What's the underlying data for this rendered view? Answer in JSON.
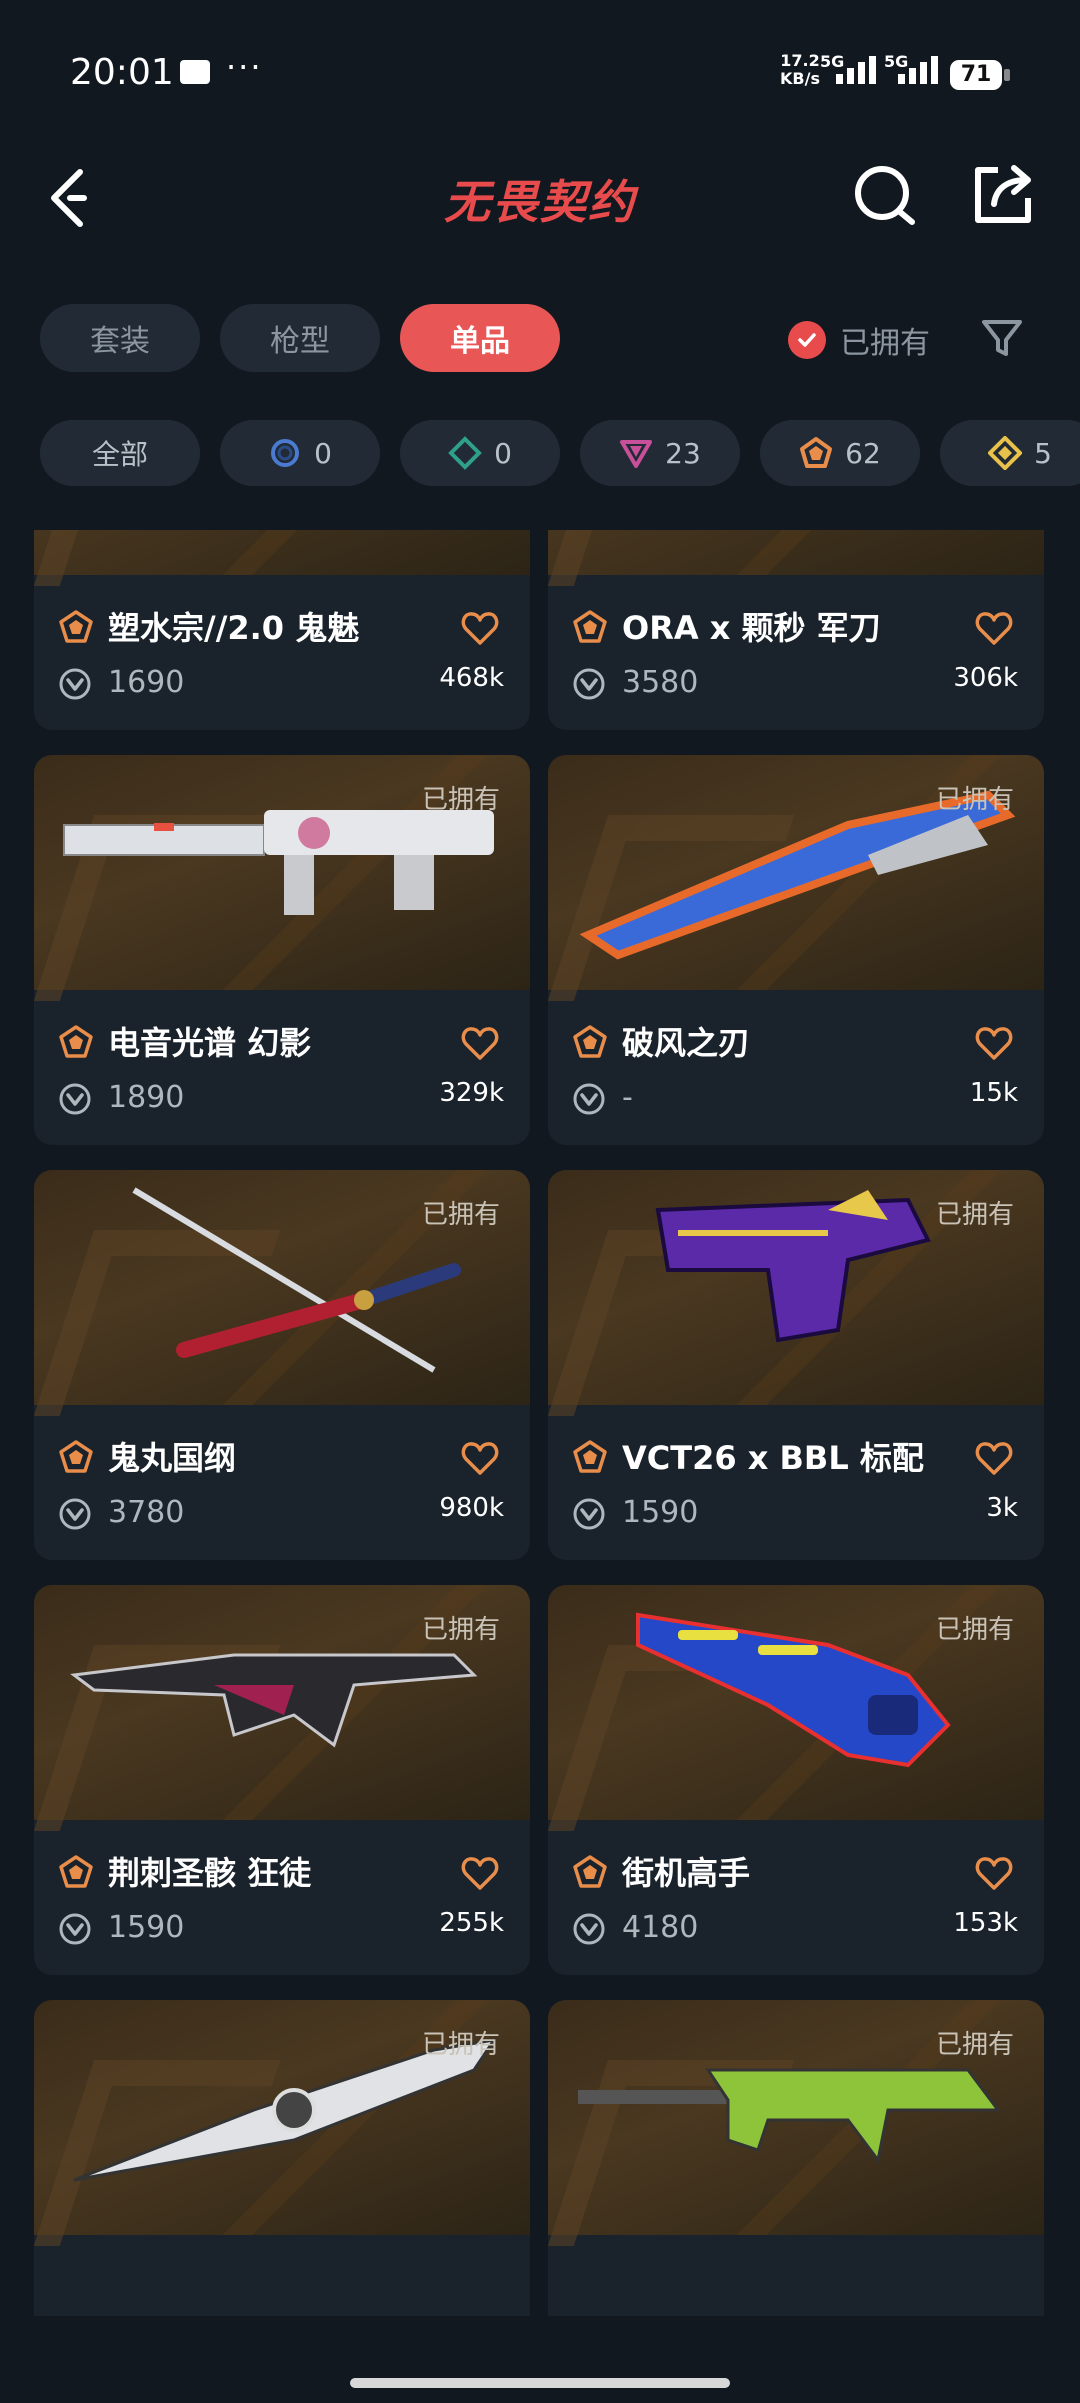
{
  "status": {
    "time": "20:01",
    "net_speed": "17.2",
    "net_unit": "KB/s",
    "sig1_label": "5G",
    "sig2_label": "5G",
    "battery": "71"
  },
  "header": {
    "logo": "无畏契约"
  },
  "tabs": [
    "套装",
    "枪型",
    "单品"
  ],
  "owned_filter_label": "已拥有",
  "tiers": [
    {
      "count": "全部",
      "icon": "all",
      "color": ""
    },
    {
      "count": "0",
      "icon": "select-tier-icon",
      "color": "#4a7bd0"
    },
    {
      "count": "0",
      "icon": "deluxe-tier-icon",
      "color": "#2fa08a"
    },
    {
      "count": "23",
      "icon": "premium-tier-icon",
      "color": "#c84f9a"
    },
    {
      "count": "62",
      "icon": "exclusive-tier-icon",
      "color": "#e88d4a"
    },
    {
      "count": "5",
      "icon": "ultra-tier-icon",
      "color": "#e8c24a"
    }
  ],
  "items": [
    {
      "name": "塑水宗//2.0 鬼魅",
      "price": "1690",
      "likes": "468k",
      "owned": ""
    },
    {
      "name": "ORA x 颗秒 军刀",
      "price": "3580",
      "likes": "306k",
      "owned": ""
    },
    {
      "name": "电音光谱 幻影",
      "price": "1890",
      "likes": "329k",
      "owned": "已拥有"
    },
    {
      "name": "破风之刃",
      "price": "-",
      "likes": "15k",
      "owned": "已拥有"
    },
    {
      "name": "鬼丸国纲",
      "price": "3780",
      "likes": "980k",
      "owned": "已拥有"
    },
    {
      "name": "VCT26 x BBL 标配",
      "price": "1590",
      "likes": "3k",
      "owned": "已拥有"
    },
    {
      "name": "荆刺圣骸 狂徒",
      "price": "1590",
      "likes": "255k",
      "owned": "已拥有"
    },
    {
      "name": "街机高手",
      "price": "4180",
      "likes": "153k",
      "owned": "已拥有"
    },
    {
      "name": "",
      "price": "",
      "likes": "",
      "owned": "已拥有"
    },
    {
      "name": "",
      "price": "",
      "likes": "",
      "owned": "已拥有"
    }
  ]
}
